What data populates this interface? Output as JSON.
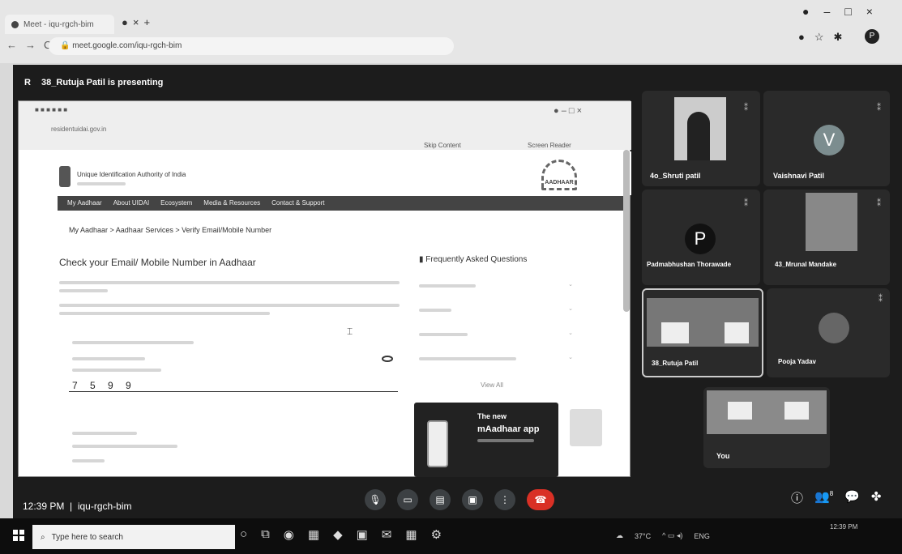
{
  "browser": {
    "tab_title": "Meet - iqu-rgch-bim",
    "url": "meet.google.com/iqu-rgch-bim",
    "profile_initial": "P"
  },
  "meet": {
    "presenter_initial": "R",
    "presenting_text": "38_Rutuja Patil is presenting",
    "meeting_code": "iqu-rgch-bim",
    "time": "12:39 PM"
  },
  "shared_screen": {
    "inner_url": "residentuidai.gov.in",
    "inner_links": [
      "Skip Content",
      "Screen Reader"
    ],
    "org_name": "Unique Identification Authority of India",
    "logo_text": "AADHAAR",
    "nav_items": [
      "My Aadhaar",
      "About UIDAI",
      "Ecosystem",
      "Media & Resources",
      "Contact & Support"
    ],
    "breadcrumb": "My Aadhaar  >  Aadhaar Services  >  Verify Email/Mobile Number",
    "page_title": "Check your Email/ Mobile Number in Aadhaar",
    "faq_title": "Frequently Asked Questions",
    "view_all": "View All",
    "digits": "7 5 9 9",
    "promo_line1": "The new",
    "promo_line2": "mAadhaar app"
  },
  "participants": [
    {
      "name": "4o_Shruti patil",
      "mic": "muted"
    },
    {
      "name": "Vaishnavi Patil",
      "initial": "V",
      "color": "#7c8d8f"
    },
    {
      "name": "Padmabhushan Thorawade",
      "initial": "P",
      "color": "#111111"
    },
    {
      "name": "43_Mrunal Mandake"
    },
    {
      "name": "38_Rutuja Patil"
    },
    {
      "name": "Pooja Yadav"
    },
    {
      "name": "You"
    }
  ],
  "controls": {
    "bottom": [
      "mic-icon",
      "camera-icon",
      "captions-icon",
      "present-icon",
      "more-icon",
      "end-call-icon"
    ],
    "right": [
      "info-icon",
      "people-icon",
      "chat-icon",
      "activities-icon"
    ],
    "people_count": "8"
  },
  "taskbar": {
    "search_placeholder": "Type here to search",
    "weather": "37°C",
    "language": "ENG"
  }
}
